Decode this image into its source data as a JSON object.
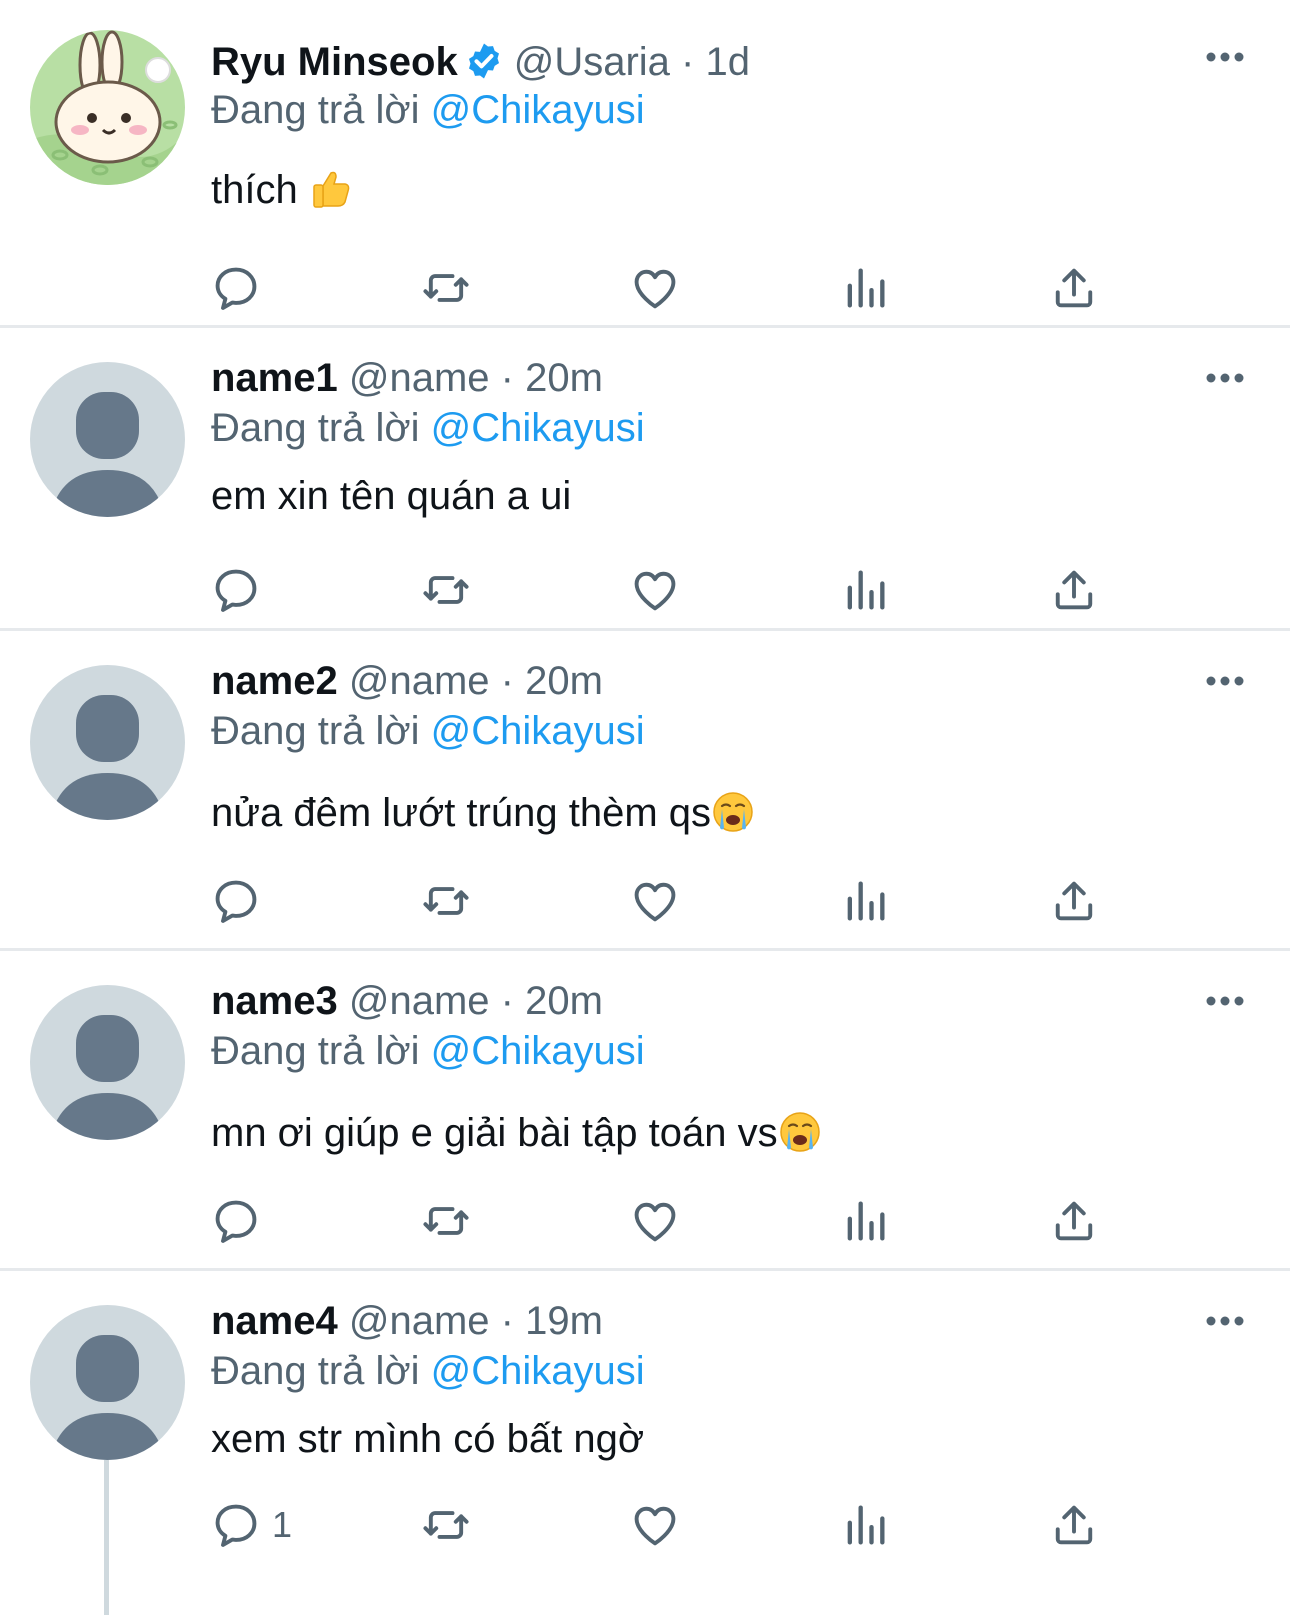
{
  "tweets": [
    {
      "display_name": "Ryu Minseok",
      "verified": true,
      "handle": "@Usaria",
      "separator": "·",
      "time": "1d",
      "reply_prefix": "Đang trả lời",
      "reply_to": "@Chikayusi",
      "text": "thích",
      "emoji": "thumbs-up",
      "reply_count": ""
    },
    {
      "display_name": "name1",
      "verified": false,
      "handle": "@name",
      "separator": "·",
      "time": "20m",
      "reply_prefix": "Đang trả lời",
      "reply_to": "@Chikayusi",
      "text": "em xin tên quán a ui",
      "emoji": "",
      "reply_count": ""
    },
    {
      "display_name": "name2",
      "verified": false,
      "handle": "@name",
      "separator": "·",
      "time": "20m",
      "reply_prefix": "Đang trả lời",
      "reply_to": "@Chikayusi",
      "text": "nửa đêm lướt trúng thèm qs",
      "emoji": "crying-face",
      "reply_count": ""
    },
    {
      "display_name": "name3",
      "verified": false,
      "handle": "@name",
      "separator": "·",
      "time": "20m",
      "reply_prefix": "Đang trả lời",
      "reply_to": "@Chikayusi",
      "text": "mn ơi giúp e giải bài tập toán vs",
      "emoji": "crying-face",
      "reply_count": ""
    },
    {
      "display_name": "name4",
      "verified": false,
      "handle": "@name",
      "separator": "·",
      "time": "19m",
      "reply_prefix": "Đang trả lời",
      "reply_to": "@Chikayusi",
      "text": "xem str mình có bất ngờ",
      "emoji": "",
      "reply_count": "1"
    }
  ],
  "icons": {
    "reply": "speech-bubble-icon",
    "retweet": "retweet-icon",
    "like": "heart-icon",
    "views": "bar-chart-icon",
    "share": "share-upload-icon",
    "more": "more-dots-icon",
    "verified": "verified-badge-icon",
    "default_avatar": "default-avatar-icon"
  },
  "colors": {
    "accent": "#1d9bf0",
    "secondary_text": "#536471",
    "primary_text": "#0f1419",
    "divider": "#e6e9ec",
    "default_avatar_bg": "#cfd9de",
    "default_avatar_fg": "#66788a"
  }
}
